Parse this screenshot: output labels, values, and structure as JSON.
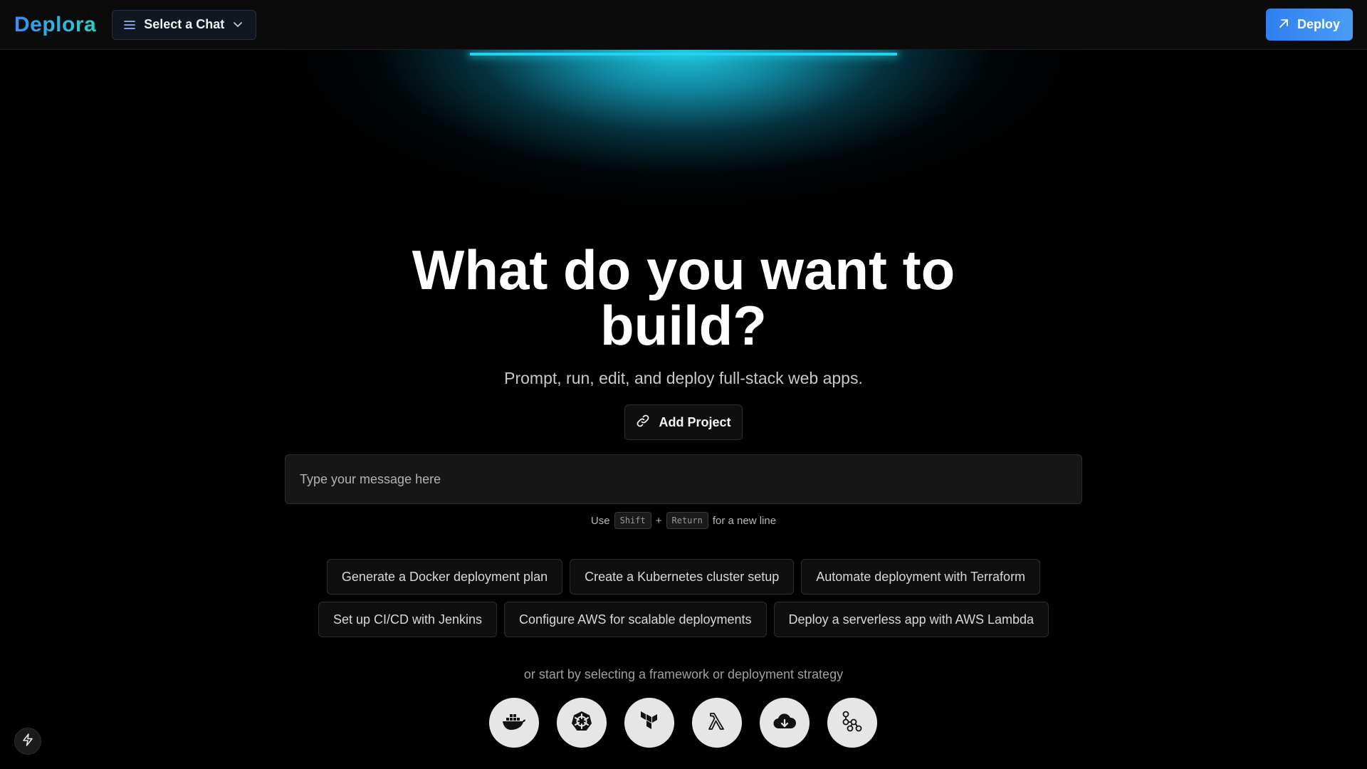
{
  "header": {
    "logo": "Deplora",
    "chat_select_label": "Select a Chat",
    "deploy_label": "Deploy"
  },
  "hero": {
    "title": "What do you want to build?",
    "subtitle": "Prompt, run, edit, and deploy full-stack web apps.",
    "add_project_label": "Add Project"
  },
  "composer": {
    "placeholder": "Type your message here",
    "hint_use": "Use",
    "hint_key1": "Shift",
    "hint_plus": "+",
    "hint_key2": "Return",
    "hint_suffix": "for a new line"
  },
  "suggestions": {
    "row1": [
      "Generate a Docker deployment plan",
      "Create a Kubernetes cluster setup",
      "Automate deployment with Terraform"
    ],
    "row2": [
      "Set up CI/CD with Jenkins",
      "Configure AWS for scalable deployments",
      "Deploy a serverless app with AWS Lambda"
    ]
  },
  "frameworks": {
    "caption": "or start by selecting a framework or deployment strategy",
    "icons": [
      "docker-icon",
      "kubernetes-icon",
      "terraform-icon",
      "lambda-icon",
      "cloud-icon",
      "pipeline-icon"
    ]
  },
  "colors": {
    "accent_cyan": "#22d3ee",
    "deploy_blue": "#2f7ff0",
    "logo_gradient_start": "#3b8ff0",
    "logo_gradient_end": "#2ad0c8"
  }
}
